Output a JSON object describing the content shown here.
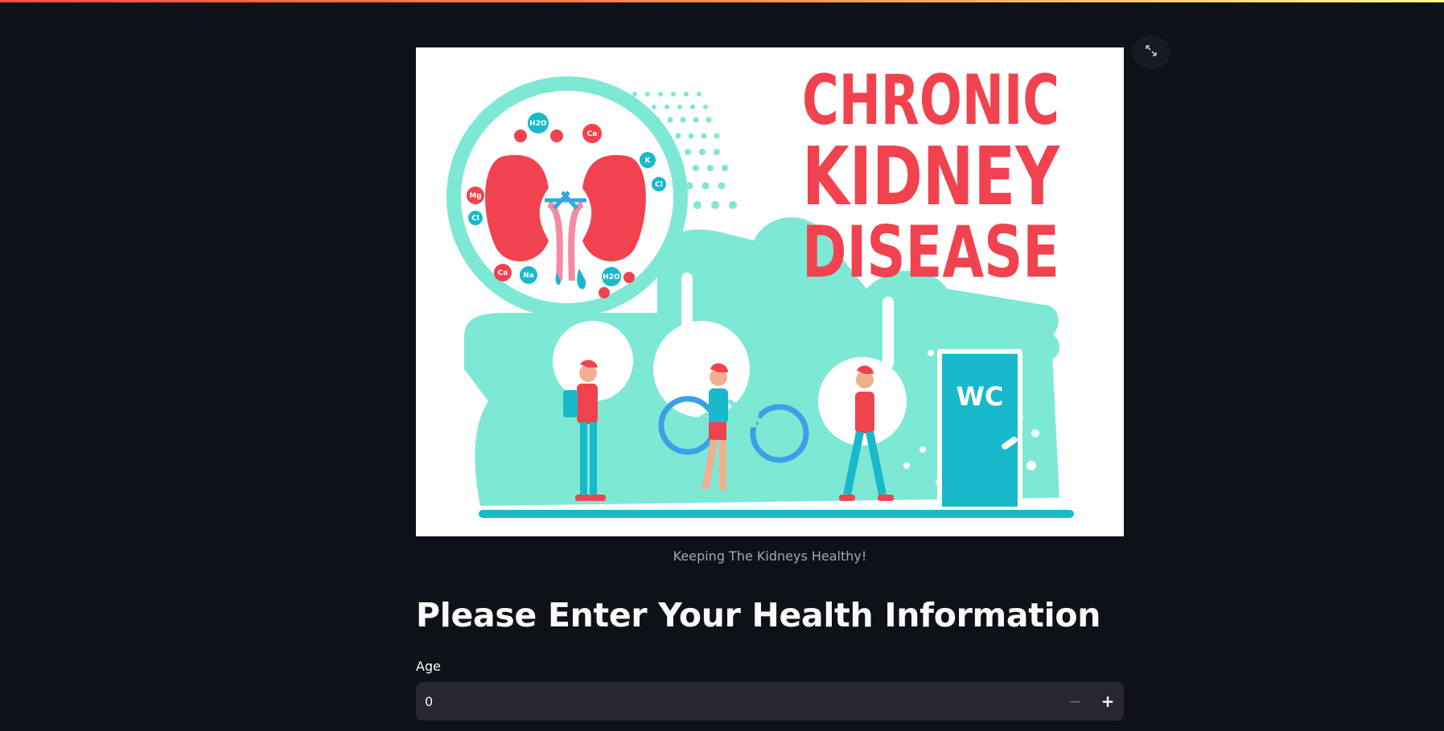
{
  "image": {
    "headline_lines": [
      "CHRONIC",
      "KIDNEY",
      "DISEASE"
    ],
    "door_label": "WC",
    "molecules": [
      "H2O",
      "Ca",
      "K",
      "Cl",
      "Mg",
      "Cl",
      "Ca",
      "Na",
      "H2O"
    ],
    "colors": {
      "headline": "#f0434f",
      "mint": "#7de9d4",
      "teal": "#19b9cc",
      "kidney": "#f0434f"
    }
  },
  "caption": "Keeping The Kidneys Healthy!",
  "fullscreen_icon": "expand-icon",
  "form": {
    "title": "Please Enter Your Health Information",
    "age": {
      "label": "Age",
      "value": "0",
      "minus": "−",
      "plus": "+"
    }
  }
}
